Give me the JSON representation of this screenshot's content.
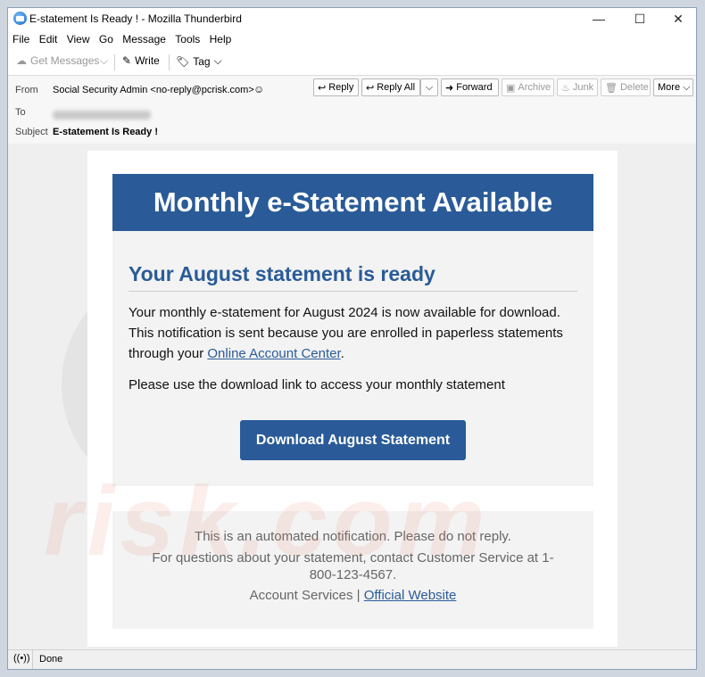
{
  "window": {
    "title": "E-statement Is Ready ! - Mozilla Thunderbird",
    "minimize": "—",
    "maximize": "☐",
    "close": "✕"
  },
  "menu": [
    "File",
    "Edit",
    "View",
    "Go",
    "Message",
    "Tools",
    "Help"
  ],
  "toolbar": {
    "get_messages": "Get Messages",
    "write": "Write",
    "tag": "Tag"
  },
  "header": {
    "from_label": "From",
    "from_value": "Social Security Admin <no-reply@pcrisk.com>",
    "to_label": "To",
    "subject_label": "Subject",
    "subject_value": "E-statement Is Ready !",
    "buttons": {
      "reply": "Reply",
      "reply_all": "Reply All",
      "forward": "Forward",
      "archive": "Archive",
      "junk": "Junk",
      "delete": "Delete",
      "more": "More"
    }
  },
  "email": {
    "banner": "Monthly e-Statement Available",
    "heading": "Your August statement is ready",
    "para1_text": "Your monthly e-statement for August 2024 is now available for download. This notification is sent because you are enrolled in paperless statements through your ",
    "para1_link": "Online Account Center",
    "para1_end": ".",
    "para2": "Please use the download link to access your monthly statement",
    "button": "Download August Statement",
    "footer_line1": "This is an automated notification. Please do not reply.",
    "footer_line2": "For questions about your statement, contact Customer Service at 1-800-123-4567.",
    "footer_line3_text": "Account Services | ",
    "footer_line3_link": "Official Website"
  },
  "status": {
    "text": "Done"
  }
}
